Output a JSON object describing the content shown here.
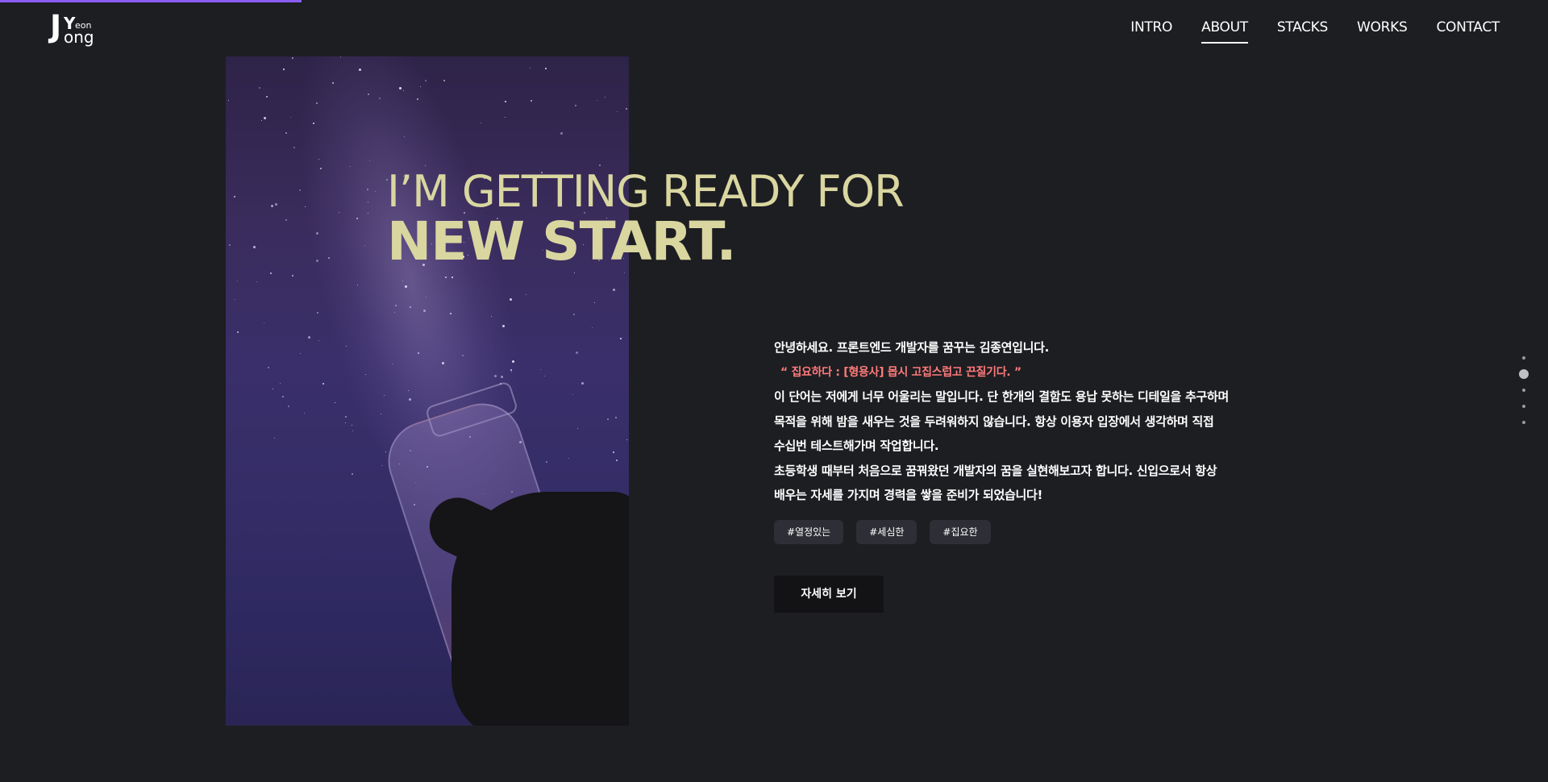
{
  "logo": {
    "j": "J",
    "y": "Y",
    "eon": "eon",
    "ong": "ong"
  },
  "nav": {
    "items": [
      {
        "label": "INTRO"
      },
      {
        "label": "ABOUT"
      },
      {
        "label": "STACKS"
      },
      {
        "label": "WORKS"
      },
      {
        "label": "CONTACT"
      }
    ]
  },
  "hero": {
    "line1": "I’M GETTING READY FOR",
    "line2": "NEW START."
  },
  "about": {
    "intro": "안녕하세요. 프론트엔드 개발자를 꿈꾸는 김종연입니다.",
    "quote": "“ 집요하다 : [형용사] 몹시 고집스럽고 끈질기다. ”",
    "line1": "이 단어는 저에게 너무 어울리는 말입니다. 단 한개의 결함도 용납 못하는 디테일을 추구하며",
    "line2": "목적을 위해 밤을 새우는 것을 두려워하지 않습니다. 항상 이용자 입장에서 생각하며 직접",
    "line3": "수십번 테스트해가며 작업합니다.",
    "line4": "초등학생 때부터 처음으로 꿈꿔왔던 개발자의 꿈을 실현해보고자 합니다. 신입으로서 항상",
    "line5": "배우는 자세를 가지며 경력을 쌓을 준비가 되었습니다!"
  },
  "tags": [
    "#열정있는",
    "#세심한",
    "#집요한"
  ],
  "more_button": "자세히 보기",
  "colors": {
    "background": "#1d1e22",
    "headline": "#d9d6a0",
    "quote": "#ff7a7a",
    "progress": "#8b5cf6"
  }
}
